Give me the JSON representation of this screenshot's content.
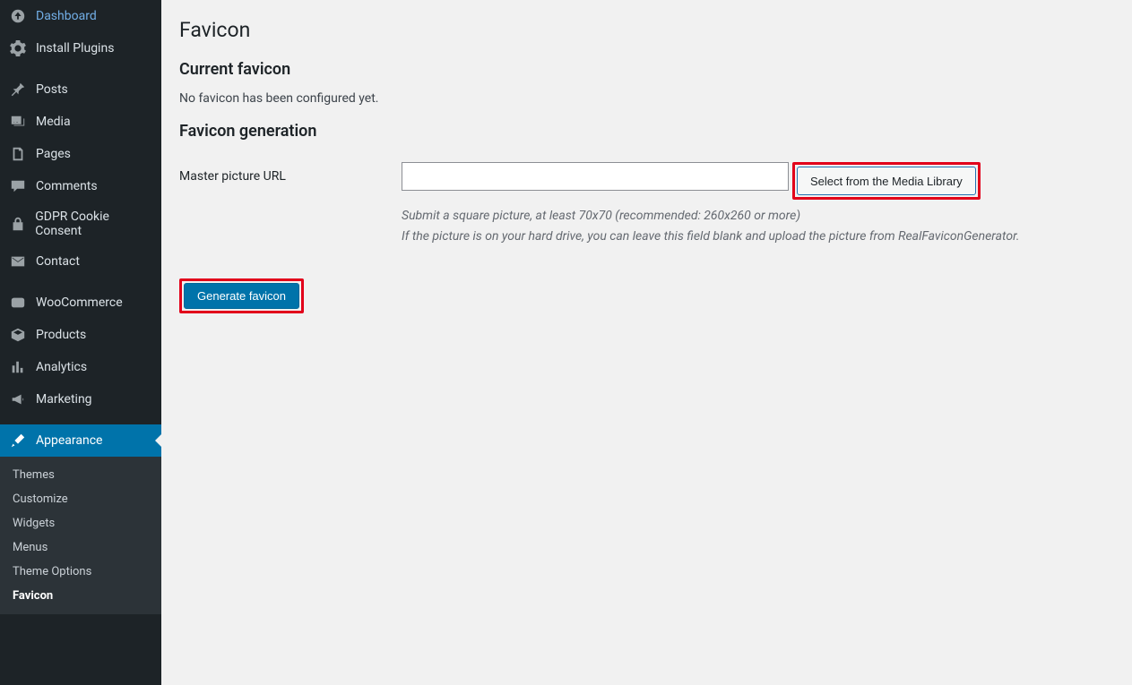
{
  "sidebar": {
    "dashboard": "Dashboard",
    "install_plugins": "Install Plugins",
    "posts": "Posts",
    "media": "Media",
    "pages": "Pages",
    "comments": "Comments",
    "gdpr": "GDPR Cookie Consent",
    "contact": "Contact",
    "woocommerce": "WooCommerce",
    "products": "Products",
    "analytics": "Analytics",
    "marketing": "Marketing",
    "appearance": "Appearance",
    "submenu": {
      "themes": "Themes",
      "customize": "Customize",
      "widgets": "Widgets",
      "menus": "Menus",
      "theme_options": "Theme Options",
      "favicon": "Favicon"
    }
  },
  "main": {
    "title": "Favicon",
    "current_heading": "Current favicon",
    "no_favicon_msg": "No favicon has been configured yet.",
    "generation_heading": "Favicon generation",
    "master_url_label": "Master picture URL",
    "master_url_value": "",
    "select_library_btn": "Select from the Media Library",
    "help_line1": "Submit a square picture, at least 70x70 (recommended: 260x260 or more)",
    "help_line2": "If the picture is on your hard drive, you can leave this field blank and upload the picture from RealFaviconGenerator.",
    "generate_btn": "Generate favicon"
  }
}
